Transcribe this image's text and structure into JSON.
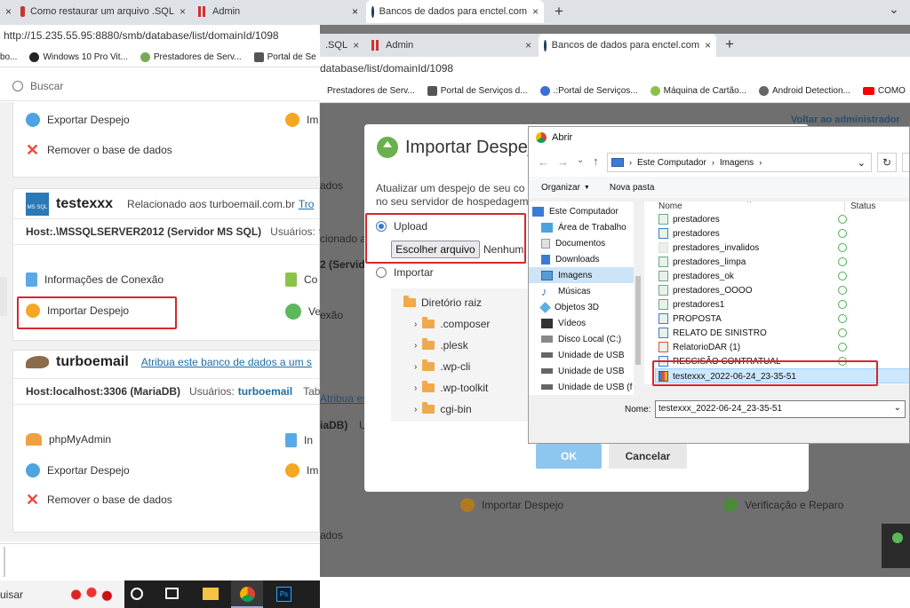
{
  "back_window": {
    "tabs": [
      {
        "label": "Como restaurar um arquivo .SQL"
      },
      {
        "label": "Admin"
      },
      {
        "label": "Bancos de dados para enctel.com"
      }
    ],
    "address": "http://15.235.55.95:8880/smb/database/list/domainId/1098",
    "bookmarks": [
      "Windows 10 Pro Vit...",
      "Prestadores de Serv...",
      "Portal de Se"
    ],
    "bookmark_prefix": "bo...",
    "search_placeholder": "Buscar",
    "db1": {
      "export": "Exportar Despejo",
      "remove": "Remover o base de dados",
      "col2_short": "Im"
    },
    "db2": {
      "name": "testexxx",
      "related": "Relacionado aos turboemail.com.br",
      "related_link": "Tro",
      "host": "Host:.\\MSSQLSERVER2012 (Servidor MS SQL)",
      "users_label": "Usuários:",
      "users_link": "tes",
      "info": "Informações de Conexão",
      "info_col2": "Co",
      "import": "Importar Despejo",
      "import_col2": "Ve"
    },
    "db3": {
      "name": "turboemail",
      "link": "Atribua este banco de dados a um s",
      "host": "Host:localhost:3306 (MariaDB)",
      "users_label": "Usuários:",
      "users_link": "turboemail",
      "tab_short": "Tab",
      "phpmyadmin": "phpMyAdmin",
      "phpmyadmin_col2": "In",
      "export": "Exportar Despejo",
      "export_col2": "Im",
      "remove": "Remover o base de dados"
    },
    "taskbar": {
      "search": "uisar"
    }
  },
  "front_window": {
    "tabs": [
      {
        "label": ".SQL"
      },
      {
        "label": "Admin"
      },
      {
        "label": "Bancos de dados para enctel.com"
      }
    ],
    "address": "database/list/domainId/1098",
    "bookmarks": [
      "Prestadores de Serv...",
      "Portal de Serviços d...",
      ".:Portal de Serviços...",
      "Máquina de Cartão...",
      "Android Detection...",
      "COMO"
    ],
    "back_link": "Voltar ao administrador",
    "bg_texts": {
      "t1": "ados",
      "t2": "cionado a",
      "t3": "2 (Servid",
      "t4": "exão",
      "t5": "Atribua es",
      "t6": "iaDB)",
      "t7": "Us",
      "t8": "ados"
    },
    "bg_import": "Importar Despejo",
    "bg_verify": "Verificação e Reparo"
  },
  "modal": {
    "title": "Importar Despejo",
    "desc_line1": "Atualizar um despejo de seu co",
    "desc_line2": "no seu servidor de hospedagem",
    "upload_label": "Upload",
    "choose_button": "Escolher arquivo",
    "no_file": "Nenhum",
    "import_label": "Importar",
    "root_dir": "Diretório raiz",
    "folders": [
      ".composer",
      ".plesk",
      ".wp-cli",
      ".wp-toolkit",
      "cgi-bin"
    ],
    "ok": "OK",
    "cancel": "Cancelar"
  },
  "file_dialog": {
    "title": "Abrir",
    "path": [
      "Este Computador",
      "Imagens"
    ],
    "organize": "Organizar",
    "new_folder": "Nova pasta",
    "col_name": "Nome",
    "col_status": "Status",
    "nav": [
      "Este Computador",
      "Área de Trabalho",
      "Documentos",
      "Downloads",
      "Imagens",
      "Músicas",
      "Objetos 3D",
      "Vídeos",
      "Disco Local (C:)",
      "Unidade de USB",
      "Unidade de USB",
      "Unidade de USB (f"
    ],
    "files": [
      "prestadores",
      "prestadores",
      "prestadores_invalidos",
      "prestadores_limpa",
      "prestadores_ok",
      "prestadores_OOOO",
      "prestadores1",
      "PROPOSTA",
      "RELATO DE SINISTRO",
      "RelatorioDAR (1)",
      "RESCISÃO CONTRATUAL",
      "testexxx_2022-06-24_23-35-51"
    ],
    "filename_label": "Nome:",
    "filename_value": "testexxx_2022-06-24_23-35-51"
  }
}
